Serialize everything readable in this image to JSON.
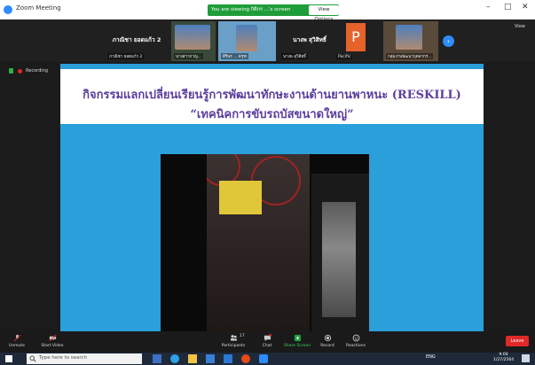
{
  "window": {
    "title": "Zoom Meeting"
  },
  "share_banner": {
    "text": "You are viewing กิติกร ...'s screen",
    "view_options": "View Options"
  },
  "window_controls": {
    "minimize": "–",
    "maximize": "□",
    "close": "✕"
  },
  "participants": [
    {
      "display": "ภาณิชา ยอดแก้ว 2",
      "label": "ภาณิชา ยอดแก้ว 2"
    },
    {
      "display": "",
      "label": "นางสาวกาญ..."
    },
    {
      "display": "",
      "label": "ศิริพร ... ครุฑ"
    },
    {
      "display": "นางพ สุวิสิทธิ์",
      "label": "นางพ สุวิสิทธิ์"
    },
    {
      "display": "P",
      "label": "Pacific"
    },
    {
      "display": "",
      "label": "กลุ่มงานพัฒนาบุคลากร..."
    }
  ],
  "strip": {
    "view_label": "View",
    "recording_label": "Recording"
  },
  "slide": {
    "title_line1": "กิจกรรมแลกเปลี่ยนเรียนรู้การพัฒนาทักษะงานด้านยานพาหนะ (RESKILL)",
    "title_line2": "“เทคนิคการขับรถบัสขนาดใหญ่”"
  },
  "toolbar": {
    "unmute": "Unmute",
    "start_video": "Start Video",
    "participants": "Participants",
    "participants_count": "17",
    "chat": "Chat",
    "share_screen": "Share Screen",
    "record": "Record",
    "reactions": "Reactions",
    "leave": "Leave"
  },
  "taskbar": {
    "search_placeholder": "Type here to search",
    "tray_text": "ENG",
    "time": "9:00",
    "date": "1/27/2564"
  },
  "colors": {
    "slide_bg": "#2a9fd9",
    "title_text": "#5b3e9e",
    "share_green": "#1f9d3a",
    "leave_red": "#e02828",
    "zoom_blue": "#2d8cff"
  }
}
